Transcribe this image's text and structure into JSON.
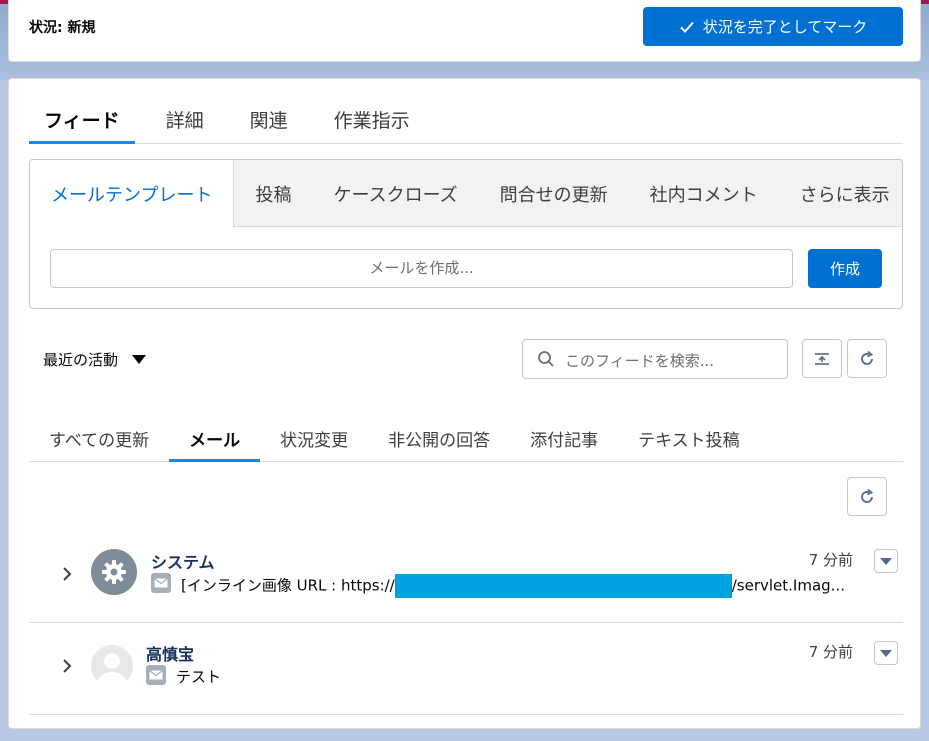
{
  "header": {
    "status_label": "状況: 新規",
    "complete_button": "状況を完了としてマーク"
  },
  "top_tabs": [
    {
      "label": "フィード",
      "active": true
    },
    {
      "label": "詳細",
      "active": false
    },
    {
      "label": "関連",
      "active": false
    },
    {
      "label": "作業指示",
      "active": false
    }
  ],
  "publisher": {
    "tabs": [
      {
        "label": "メールテンプレート",
        "active": true
      },
      {
        "label": "投稿",
        "active": false
      },
      {
        "label": "ケースクローズ",
        "active": false
      },
      {
        "label": "問合せの更新",
        "active": false
      },
      {
        "label": "社内コメント",
        "active": false
      },
      {
        "label": "さらに表示",
        "active": false
      }
    ],
    "compose_placeholder": "メールを作成...",
    "compose_button": "作成"
  },
  "feed_controls": {
    "activity_filter": "最近の活動",
    "search_placeholder": "このフィードを検索..."
  },
  "feed_tabs": [
    {
      "label": "すべての更新",
      "active": false
    },
    {
      "label": "メール",
      "active": true
    },
    {
      "label": "状況変更",
      "active": false
    },
    {
      "label": "非公開の回答",
      "active": false
    },
    {
      "label": "添付記事",
      "active": false
    },
    {
      "label": "テキスト投稿",
      "active": false
    }
  ],
  "feed_items": [
    {
      "author": "システム",
      "time": "7 分前",
      "body_prefix": "[インライン画像 URL : https://",
      "body_suffix": "/servlet.Imag...",
      "avatar_icon": "gear-icon"
    },
    {
      "author": "高慎宝",
      "time": "7 分前",
      "body_prefix": "テスト",
      "body_suffix": "",
      "avatar_icon": "user-avatar"
    }
  ],
  "colors": {
    "brand": "#0070d2",
    "accent": "#a3174e",
    "tab_underline": "#1589ee",
    "redaction": "#00a1e0"
  }
}
